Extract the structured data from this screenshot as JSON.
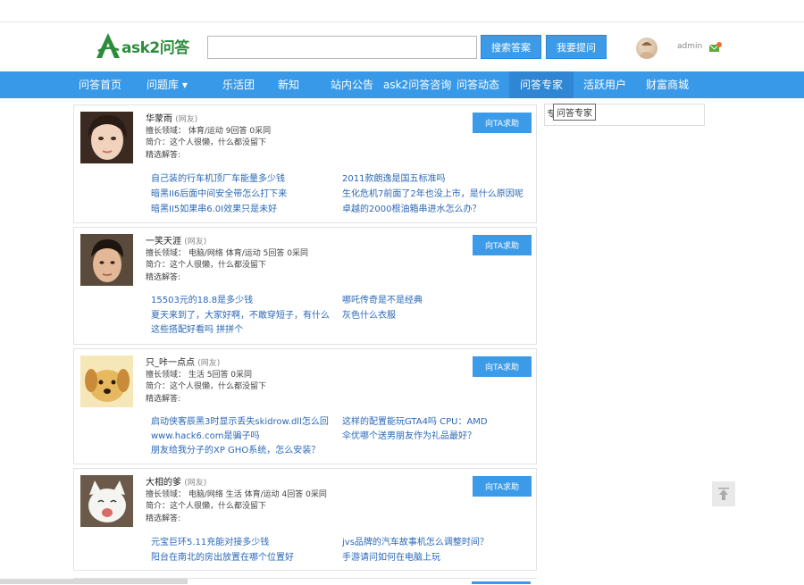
{
  "header": {
    "logo_text": "ask2问答",
    "search_placeholder": "",
    "search_button": "搜索答案",
    "ask_button": "我要提问",
    "username": "admin"
  },
  "nav": {
    "items": [
      {
        "label": "问答首页"
      },
      {
        "label": "问题库 ▾"
      },
      {
        "label": "乐活团"
      },
      {
        "label": "新知"
      },
      {
        "label": "站内公告"
      },
      {
        "label": "ask2问答咨询"
      },
      {
        "label": "问答动态"
      },
      {
        "label": "问答专家",
        "active": true
      },
      {
        "label": "活跃用户"
      },
      {
        "label": "财富商城"
      }
    ]
  },
  "tooltip": "问答专家",
  "sidebar": {
    "box_text": "专家排行榜"
  },
  "experts": [
    {
      "name": "华蒙雨",
      "tag": "(网友)",
      "field": "擅长领域：  体育/运动 9回答 0采同",
      "intro": "简介：这个人很懒，什么都没留下",
      "best_label": "精选解答:",
      "answers_left": [
        "自己装的行车机顶厂车能量多少钱",
        "暗黑II6后面中间安全带怎么打下来",
        "暗黑II5如果串6.0I效果只是未好"
      ],
      "answers_right": [
        "2011款朗逸是国五标准吗",
        "生化危机7前面了2年也没上市，是什么原因呢",
        "卓越的2000根油箱串进水怎么办？"
      ],
      "help_button": "向TA求助"
    },
    {
      "name": "一笑天涯",
      "tag": "(网友)",
      "field": "擅长领域：  电脑/网络 体育/运动 5回答 0采同",
      "intro": "简介：这个人很懒，什么都没留下",
      "best_label": "精选解答:",
      "answers_left": [
        "15503元的18.8是多少钱",
        "夏天来到了，大家好啊，不敢穿短子，有什么",
        "这些搭配好看吗 拼拼个"
      ],
      "answers_right": [
        "哪吒传奇是不是经典",
        "灰色什么衣服"
      ],
      "help_button": "向TA求助"
    },
    {
      "name": "只_咔一点点",
      "tag": "(网友)",
      "field": "擅长领域：  生活 5回答 0采同",
      "intro": "简介：这个人很懒，什么都没留下",
      "best_label": "精选解答:",
      "answers_left": [
        "启动侠客辰黑3时显示丢失skidrow.dll怎么回",
        "www.hack6.com是骗子吗",
        "朋友给我分子的XP GHO系统，怎么安装？"
      ],
      "answers_right": [
        "这样的配置能玩GTA4吗 CPU：AMD",
        "伞优哪个送男朋友作为礼品最好？"
      ],
      "help_button": "向TA求助"
    },
    {
      "name": "大相的爹",
      "tag": "(网友)",
      "field": "擅长领域：  电脑/网络 生活 体育/运动 4回答 0采同",
      "intro": "简介：这个人很懒，什么都没留下",
      "best_label": "精选解答:",
      "answers_left": [
        "元宝巨环5.11充能对接多少钱",
        "阳台在南北的房出放置在哪个位置好"
      ],
      "answers_right": [
        "jvs品牌的汽车故事机怎么调整时间？",
        "手游请问如何在电脑上玩"
      ],
      "help_button": "向TA求助"
    }
  ]
}
